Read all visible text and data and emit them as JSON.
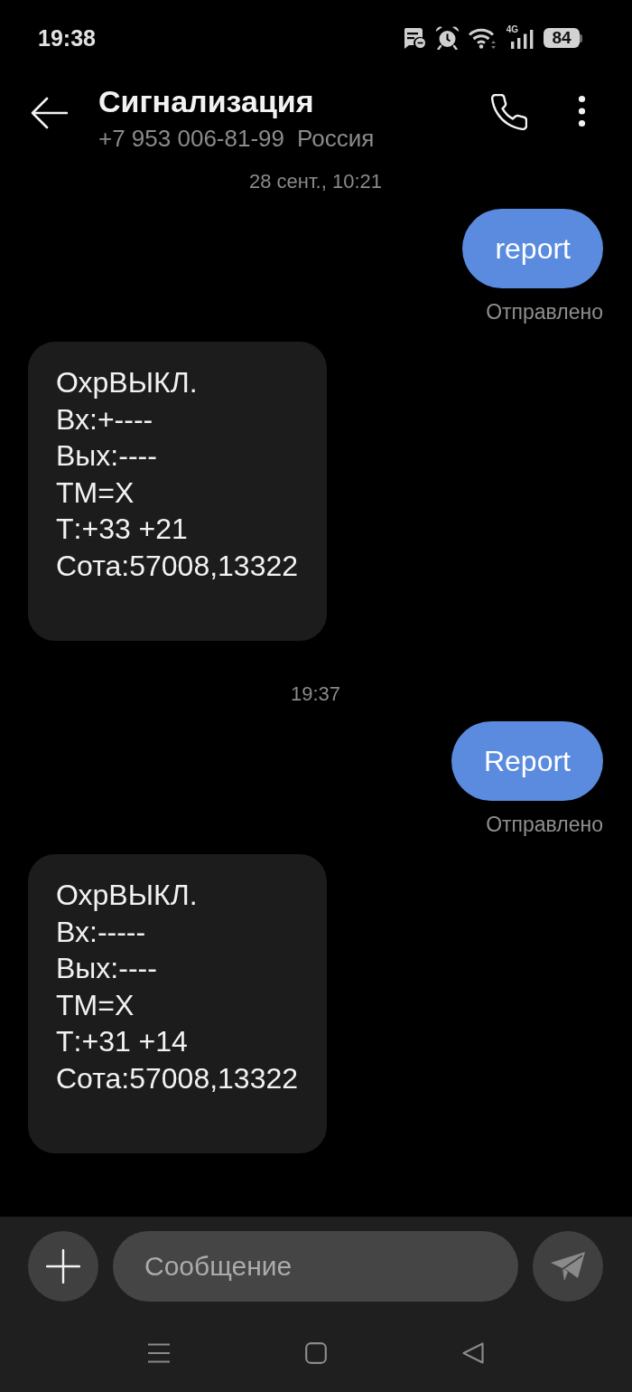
{
  "status_bar": {
    "time": "19:38",
    "network": "4G",
    "battery": "84"
  },
  "header": {
    "title": "Сигнализация",
    "phone": "+7 953 006-81-99",
    "region": "Россия"
  },
  "messages": [
    {
      "kind": "timestamp",
      "text": "28 сент., 10:21"
    },
    {
      "kind": "outgoing",
      "text": "report",
      "status": "Отправлено"
    },
    {
      "kind": "incoming",
      "lines": [
        "ОхрВЫКЛ.",
        "Вх:+----",
        "Вых:----",
        "ТМ=Х",
        "Т:+33 +21",
        "Сота:57008,13322"
      ]
    },
    {
      "kind": "timestamp",
      "text": "19:37"
    },
    {
      "kind": "outgoing",
      "text": "Report",
      "status": "Отправлено"
    },
    {
      "kind": "incoming",
      "lines": [
        "ОхрВЫКЛ.",
        "Вх:-----",
        "Вых:----",
        "ТМ=Х",
        "Т:+31 +14",
        "Сота:57008,13322"
      ]
    }
  ],
  "composer": {
    "placeholder": "Сообщение"
  }
}
